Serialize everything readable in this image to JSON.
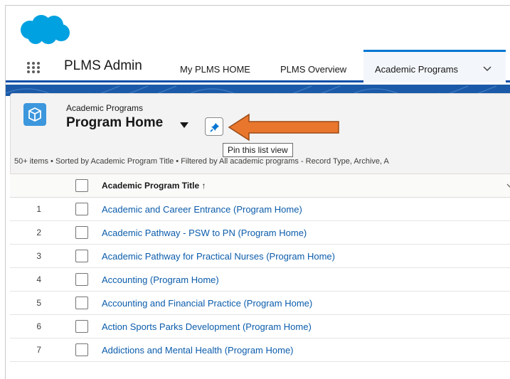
{
  "header": {
    "logo": "salesforce-cloud-logo",
    "brand_color": "#00a1e0"
  },
  "app_nav": {
    "app_name": "PLMS Admin",
    "items": [
      {
        "label": "My PLMS HOME"
      },
      {
        "label": "PLMS Overview"
      }
    ],
    "active_tab": {
      "label": "Academic Programs",
      "icon": "chevron-down-icon"
    }
  },
  "list_view": {
    "object_label": "Academic Programs",
    "title": "Program Home",
    "pin_tooltip": "Pin this list view",
    "meta_text": "50+ items • Sorted by Academic Program Title • Filtered by All academic programs - Record Type, Archive, A",
    "accent_color": "#e8762d"
  },
  "table": {
    "column_header": "Academic Program Title ↑",
    "rows": [
      {
        "num": "1",
        "title": "Academic and Career Entrance (Program Home)"
      },
      {
        "num": "2",
        "title": "Academic Pathway - PSW to PN (Program Home)"
      },
      {
        "num": "3",
        "title": "Academic Pathway for Practical Nurses (Program Home)"
      },
      {
        "num": "4",
        "title": "Accounting (Program Home)"
      },
      {
        "num": "5",
        "title": "Accounting and Financial Practice (Program Home)"
      },
      {
        "num": "6",
        "title": "Action Sports Parks Development (Program Home)"
      },
      {
        "num": "7",
        "title": "Addictions and Mental Health (Program Home)"
      }
    ]
  }
}
